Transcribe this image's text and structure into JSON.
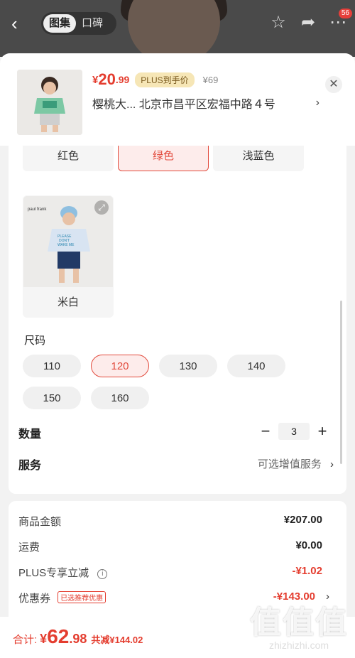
{
  "top": {
    "tabs": [
      "图集",
      "口碑"
    ],
    "badge": "56"
  },
  "header": {
    "price_currency": "¥",
    "price_int": "20",
    "price_dec": ".99",
    "plus_tag": "PLUS到手价",
    "original_price": "¥69",
    "address": "樱桃大...  北京市昌平区宏福中路４号"
  },
  "colors": {
    "items": [
      "红色",
      "绿色",
      "浅蓝色",
      "米白"
    ],
    "selected": "绿色",
    "brand_text": "paul frank",
    "shirt_text": "PLEASE DON'T WAKE ME YOU'RE"
  },
  "size": {
    "title": "尺码",
    "options": [
      "110",
      "120",
      "130",
      "140",
      "150",
      "160"
    ],
    "selected": "120"
  },
  "quantity": {
    "label": "数量",
    "minus": "−",
    "value": "3",
    "plus": "+"
  },
  "service": {
    "label": "服务",
    "value": "可选增值服务"
  },
  "summary": {
    "goods_label": "商品金额",
    "goods_value": "¥207.00",
    "shipping_label": "运费",
    "shipping_value": "¥0.00",
    "plus_label": "PLUS专享立减",
    "plus_value": "-¥1.02",
    "coupon_label": "优惠券",
    "coupon_tag": "已选推荐优惠",
    "coupon_value": "-¥143.00"
  },
  "bottom": {
    "total_label": "合计:",
    "currency": "¥",
    "total_int": "62",
    "total_dec": ".98",
    "saved": "共减¥144.02"
  },
  "watermark": {
    "big": "值值值",
    "small": "zhizhizhi.com"
  },
  "colors_theme": {
    "accent": "#e43d2f",
    "plus_bg": "#f6e6b6"
  }
}
